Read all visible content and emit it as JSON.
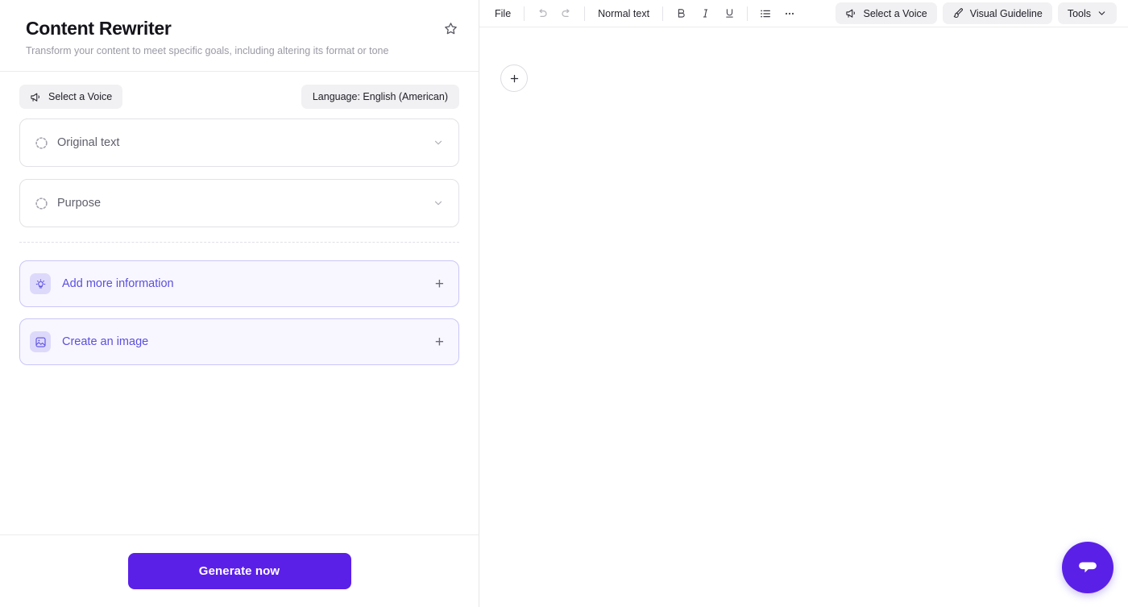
{
  "left_panel": {
    "title": "Content Rewriter",
    "subtitle": "Transform your content to meet specific goals, including altering its format or tone",
    "favorite_icon": "star-icon",
    "voice_button": {
      "label": "Select a Voice",
      "icon": "megaphone-icon"
    },
    "language_button": {
      "label": "Language: English (American)"
    },
    "accordions": [
      {
        "label": "Original text",
        "icon": "dashed-circle-icon",
        "chevron": "chevron-down-icon"
      },
      {
        "label": "Purpose",
        "icon": "dashed-circle-icon",
        "chevron": "chevron-down-icon"
      }
    ],
    "action_cards": [
      {
        "label": "Add more information",
        "icon": "lightbulb-icon",
        "action": "+"
      },
      {
        "label": "Create an image",
        "icon": "image-icon",
        "action": "+"
      }
    ],
    "generate_button": "Generate now"
  },
  "editor": {
    "toolbar": {
      "file_menu": "File",
      "undo_icon": "undo-icon",
      "redo_icon": "redo-icon",
      "text_style": "Normal text",
      "bold_icon": "bold-icon",
      "italic_icon": "italic-icon",
      "underline_icon": "underline-icon",
      "list_icon": "bulleted-list-icon",
      "more_icon": "ellipsis-icon",
      "voice_button": {
        "label": "Select a Voice",
        "icon": "megaphone-icon"
      },
      "visual_guideline_button": {
        "label": "Visual Guideline",
        "icon": "paintbrush-icon"
      },
      "tools_button": {
        "label": "Tools",
        "icon": "chevron-down-icon"
      }
    },
    "add_block_icon": "plus-icon",
    "chat_fab_icon": "chat-bubble-icon"
  },
  "colors": {
    "accent": "#5b20e8",
    "accent_soft_bg": "#f8f7ff",
    "accent_soft_border": "#c9c6f7",
    "accent_badge": "#ddd9fb",
    "accent_text": "#5b4fe0",
    "pill_bg": "#f1f1f3",
    "border": "#e7e7ea"
  }
}
